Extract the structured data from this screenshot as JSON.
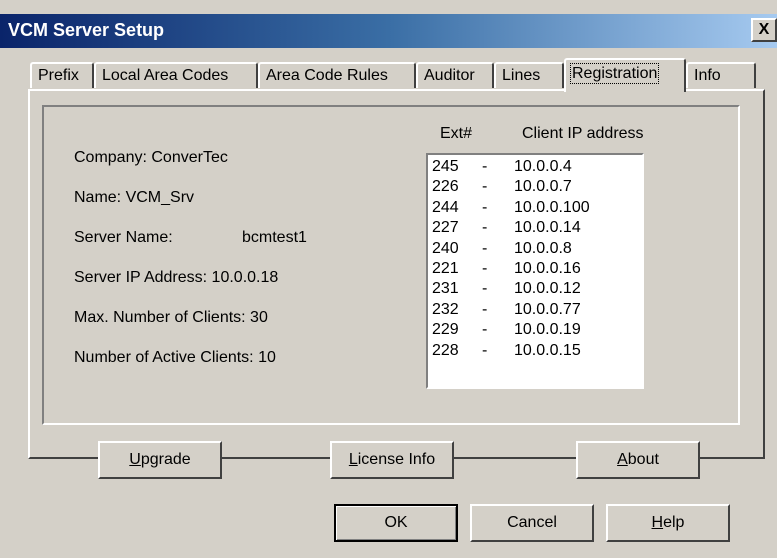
{
  "window": {
    "title": "VCM Server Setup",
    "close_glyph": "X"
  },
  "tabs": [
    {
      "label": "Prefix"
    },
    {
      "label": "Local Area Codes"
    },
    {
      "label": "Area Code Rules"
    },
    {
      "label": "Auditor"
    },
    {
      "label": "Lines"
    },
    {
      "label": "Registration",
      "active": true
    },
    {
      "label": "Info"
    }
  ],
  "registration": {
    "company": "Company:  ConverTec",
    "name": "Name:  VCM_Srv",
    "server_name_label": "Server Name:",
    "server_name_value": "bcmtest1",
    "server_ip": "Server IP Address: 10.0.0.18",
    "max_clients": "Max. Number of Clients:  30",
    "active_clients": "Number of Active Clients:  10",
    "col_ext": "Ext#",
    "col_ip": "Client IP address",
    "clients": [
      {
        "ext": "245",
        "sep": "-",
        "ip": "10.0.0.4"
      },
      {
        "ext": "226",
        "sep": "-",
        "ip": "10.0.0.7"
      },
      {
        "ext": "244",
        "sep": "-",
        "ip": "10.0.0.100"
      },
      {
        "ext": "227",
        "sep": "-",
        "ip": "10.0.0.14"
      },
      {
        "ext": "240",
        "sep": "-",
        "ip": "10.0.0.8"
      },
      {
        "ext": "221",
        "sep": "-",
        "ip": "10.0.0.16"
      },
      {
        "ext": "231",
        "sep": "-",
        "ip": "10.0.0.12"
      },
      {
        "ext": "232",
        "sep": "-",
        "ip": "10.0.0.77"
      },
      {
        "ext": "229",
        "sep": "-",
        "ip": "10.0.0.19"
      },
      {
        "ext": "228",
        "sep": "-",
        "ip": "10.0.0.15"
      }
    ]
  },
  "panel_buttons": {
    "upgrade_first": "U",
    "upgrade_rest": "pgrade",
    "license_first": "L",
    "license_rest": "icense Info",
    "about_first": "A",
    "about_rest": "bout"
  },
  "dialog_buttons": {
    "ok": "OK",
    "cancel": "Cancel",
    "help_first": "H",
    "help_rest": "elp"
  }
}
